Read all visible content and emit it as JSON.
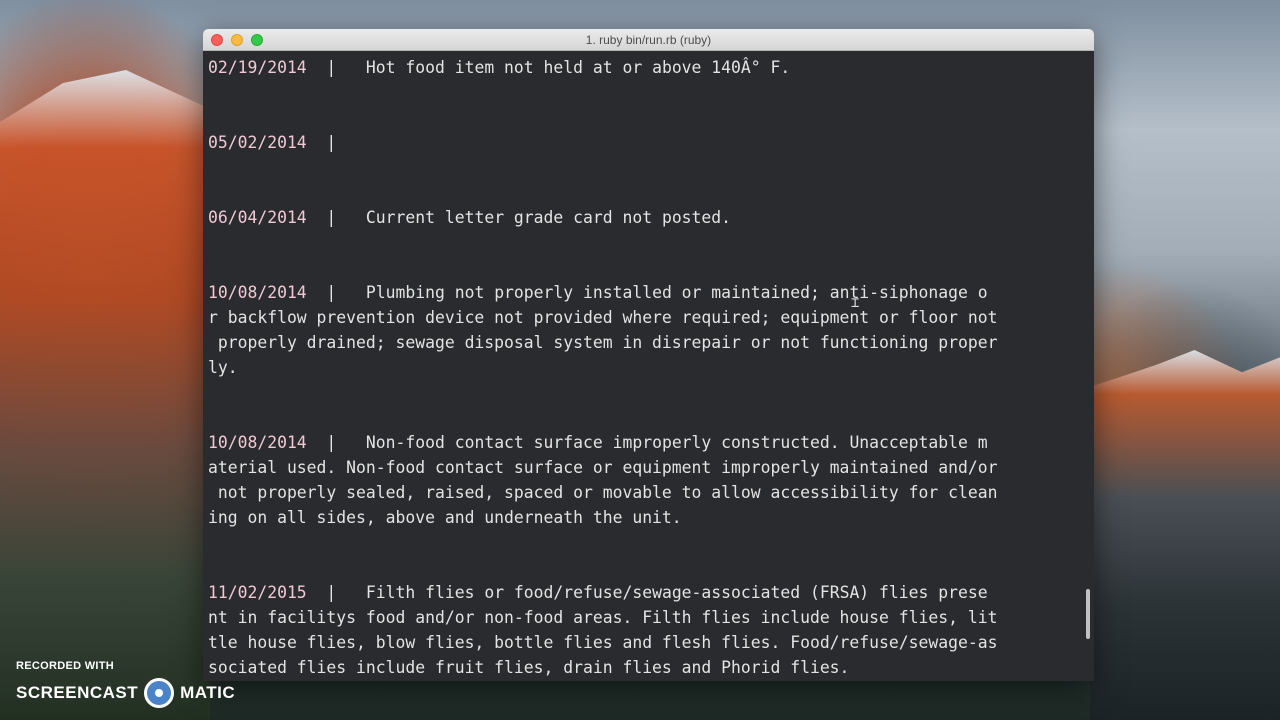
{
  "window": {
    "title": "1. ruby bin/run.rb (ruby)"
  },
  "terminal": {
    "lines": [
      {
        "date": "02/19/2014",
        "sep": "  |   ",
        "text": "Hot food item not held at or above 140Â° F."
      },
      {
        "date": "",
        "sep": "",
        "text": ""
      },
      {
        "date": "",
        "sep": "",
        "text": ""
      },
      {
        "date": "05/02/2014",
        "sep": "  |   ",
        "text": ""
      },
      {
        "date": "",
        "sep": "",
        "text": ""
      },
      {
        "date": "",
        "sep": "",
        "text": ""
      },
      {
        "date": "06/04/2014",
        "sep": "  |   ",
        "text": "Current letter grade card not posted."
      },
      {
        "date": "",
        "sep": "",
        "text": ""
      },
      {
        "date": "",
        "sep": "",
        "text": ""
      },
      {
        "date": "10/08/2014",
        "sep": "  |   ",
        "text": "Plumbing not properly installed or maintained; anti-siphonage o"
      },
      {
        "date": "",
        "sep": "",
        "text": "r backflow prevention device not provided where required; equipment or floor not"
      },
      {
        "date": "",
        "sep": "",
        "text": " properly drained; sewage disposal system in disrepair or not functioning proper"
      },
      {
        "date": "",
        "sep": "",
        "text": "ly."
      },
      {
        "date": "",
        "sep": "",
        "text": ""
      },
      {
        "date": "",
        "sep": "",
        "text": ""
      },
      {
        "date": "10/08/2014",
        "sep": "  |   ",
        "text": "Non-food contact surface improperly constructed. Unacceptable m"
      },
      {
        "date": "",
        "sep": "",
        "text": "aterial used. Non-food contact surface or equipment improperly maintained and/or"
      },
      {
        "date": "",
        "sep": "",
        "text": " not properly sealed, raised, spaced or movable to allow accessibility for clean"
      },
      {
        "date": "",
        "sep": "",
        "text": "ing on all sides, above and underneath the unit."
      },
      {
        "date": "",
        "sep": "",
        "text": ""
      },
      {
        "date": "",
        "sep": "",
        "text": ""
      },
      {
        "date": "11/02/2015",
        "sep": "  |   ",
        "text": "Filth flies or food/refuse/sewage-associated (FRSA) flies prese"
      },
      {
        "date": "",
        "sep": "",
        "text": "nt in facilitys food and/or non-food areas. Filth flies include house flies, lit"
      },
      {
        "date": "",
        "sep": "",
        "text": "tle house flies, blow flies, bottle flies and flesh flies. Food/refuse/sewage-as"
      },
      {
        "date": "",
        "sep": "",
        "text": "sociated flies include fruit flies, drain flies and Phorid flies."
      }
    ]
  },
  "watermark": {
    "small": "RECORDED WITH",
    "left": "SCREENCAST",
    "right": "MATIC"
  }
}
